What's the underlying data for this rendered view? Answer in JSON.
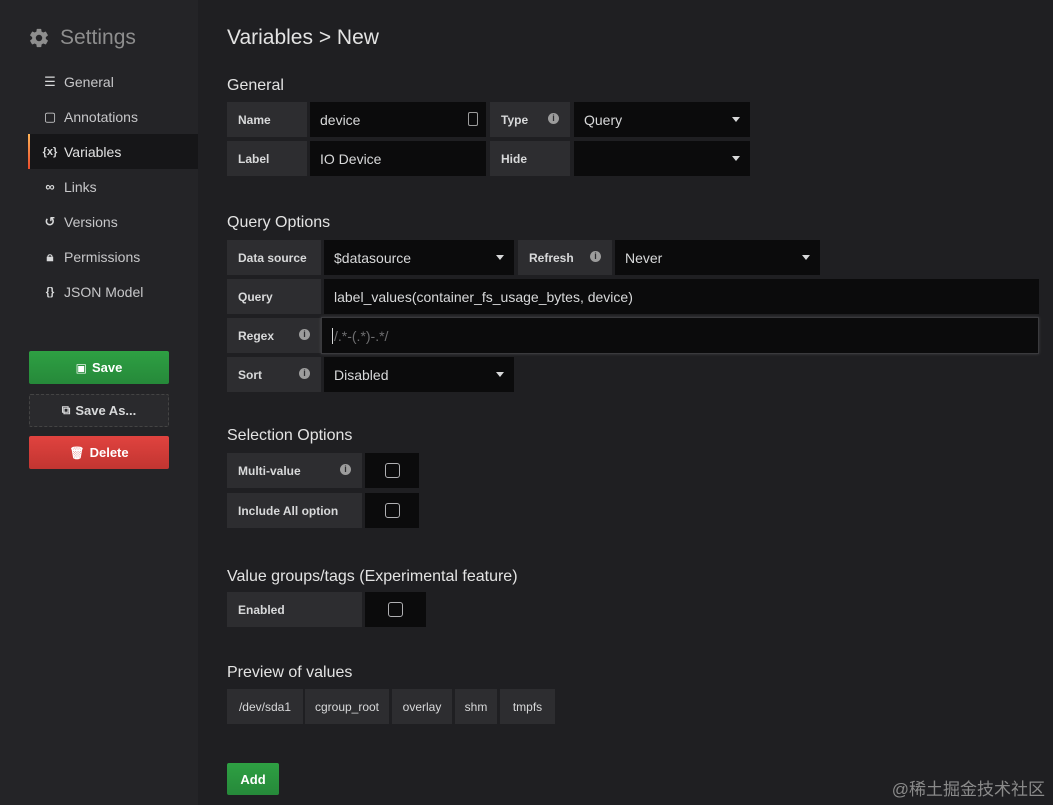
{
  "sidebar": {
    "title": "Settings",
    "items": [
      {
        "label": "General",
        "icon": "sliders-icon"
      },
      {
        "label": "Annotations",
        "icon": "comment-icon"
      },
      {
        "label": "Variables",
        "icon": "variable-icon",
        "active": true
      },
      {
        "label": "Links",
        "icon": "link-icon"
      },
      {
        "label": "Versions",
        "icon": "history-icon"
      },
      {
        "label": "Permissions",
        "icon": "lock-icon"
      },
      {
        "label": "JSON Model",
        "icon": "json-icon"
      }
    ],
    "save_label": "Save",
    "save_as_label": "Save As...",
    "delete_label": "Delete"
  },
  "page": {
    "title": "Variables > New"
  },
  "general": {
    "heading": "General",
    "name_label": "Name",
    "name_value": "device",
    "type_label": "Type",
    "type_value": "Query",
    "label_label": "Label",
    "label_value": "IO Device",
    "hide_label": "Hide",
    "hide_value": ""
  },
  "query_options": {
    "heading": "Query Options",
    "datasource_label": "Data source",
    "datasource_value": "$datasource",
    "refresh_label": "Refresh",
    "refresh_value": "Never",
    "query_label": "Query",
    "query_value": "label_values(container_fs_usage_bytes, device)",
    "regex_label": "Regex",
    "regex_placeholder": "/.*-(.*)-.*/",
    "sort_label": "Sort",
    "sort_value": "Disabled"
  },
  "selection_options": {
    "heading": "Selection Options",
    "multi_value_label": "Multi-value",
    "multi_value_checked": false,
    "include_all_label": "Include All option",
    "include_all_checked": false
  },
  "value_groups": {
    "heading": "Value groups/tags (Experimental feature)",
    "enabled_label": "Enabled",
    "enabled_checked": false
  },
  "preview": {
    "heading": "Preview of values",
    "values": [
      "/dev/sda1",
      "cgroup_root",
      "overlay",
      "shm",
      "tmpfs"
    ]
  },
  "add_label": "Add",
  "watermark": "@稀土掘金技术社区",
  "colors": {
    "accent_green": "#2ea043",
    "danger_red": "#e0433f",
    "active_bar": "#eb7b2b"
  }
}
